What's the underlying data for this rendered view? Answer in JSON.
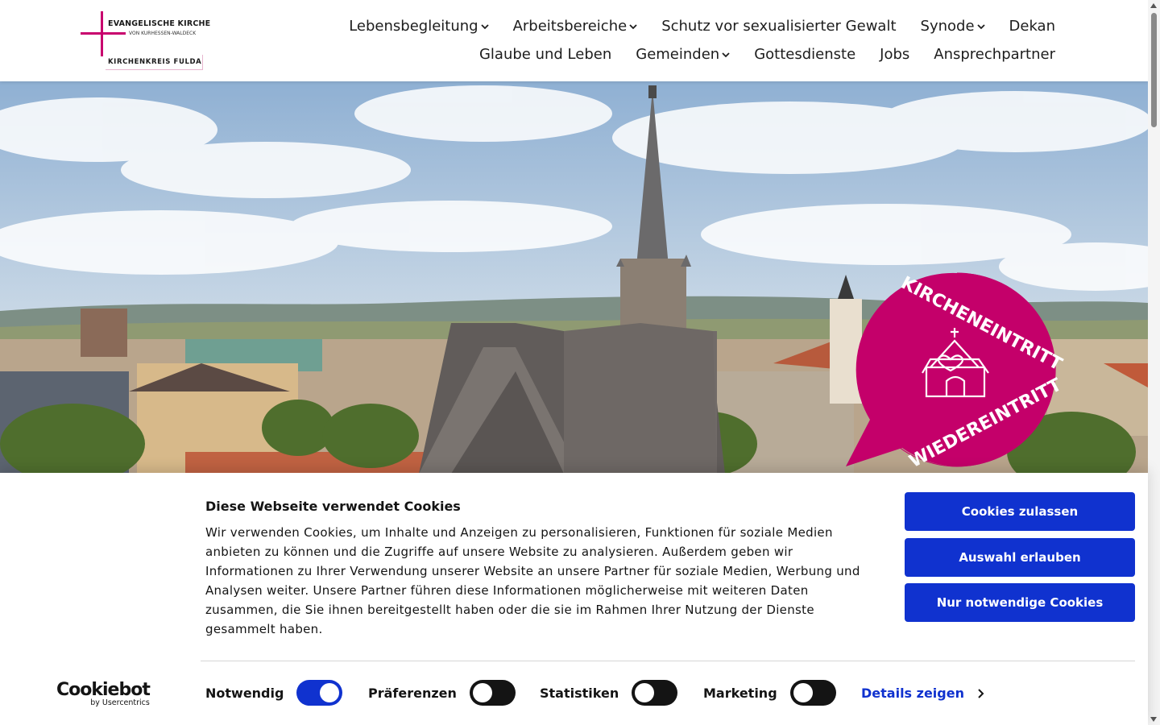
{
  "logo": {
    "line1": "EVANGELISCHE KIRCHE",
    "line2": "VON KURHESSEN-WALDECK",
    "line3": "KIRCHENKREIS FULDA"
  },
  "nav": {
    "row1": [
      {
        "label": "Lebensbegleitung",
        "has_dropdown": true
      },
      {
        "label": "Arbeitsbereiche",
        "has_dropdown": true
      },
      {
        "label": "Schutz vor sexualisierter Gewalt",
        "has_dropdown": false
      },
      {
        "label": "Synode",
        "has_dropdown": true
      },
      {
        "label": "Dekan",
        "has_dropdown": false
      }
    ],
    "row2": [
      {
        "label": "Glaube und Leben",
        "has_dropdown": false
      },
      {
        "label": "Gemeinden",
        "has_dropdown": true
      },
      {
        "label": "Gottesdienste",
        "has_dropdown": false
      },
      {
        "label": "Jobs",
        "has_dropdown": false
      },
      {
        "label": "Ansprechpartner",
        "has_dropdown": false
      }
    ]
  },
  "hero": {
    "badge_top": "KIRCHENEINTRITT",
    "badge_bottom": "WIEDEREINTRITT",
    "badge_color": "#c4006a"
  },
  "cookie": {
    "title": "Diese Webseite verwendet Cookies",
    "text": "Wir verwenden Cookies, um Inhalte und Anzeigen zu personalisieren, Funktionen für soziale Medien anbieten zu können und die Zugriffe auf unsere Website zu analysieren. Außerdem geben wir Informationen zu Ihrer Verwendung unserer Website an unsere Partner für soziale Medien, Werbung und Analysen weiter. Unsere Partner führen diese Informationen möglicherweise mit weiteren Daten zusammen, die Sie ihnen bereitgestellt haben oder die sie im Rahmen Ihrer Nutzung der Dienste gesammelt haben.",
    "buttons": {
      "allow_all": "Cookies zulassen",
      "allow_selection": "Auswahl erlauben",
      "necessary_only": "Nur notwendige Cookies"
    },
    "toggles": [
      {
        "label": "Notwendig",
        "on": true
      },
      {
        "label": "Präferenzen",
        "on": false
      },
      {
        "label": "Statistiken",
        "on": false
      },
      {
        "label": "Marketing",
        "on": false
      }
    ],
    "details_label": "Details zeigen",
    "brand_name": "Cookiebot",
    "brand_sub": "by Usercentrics",
    "accent_color": "#1032cf"
  }
}
